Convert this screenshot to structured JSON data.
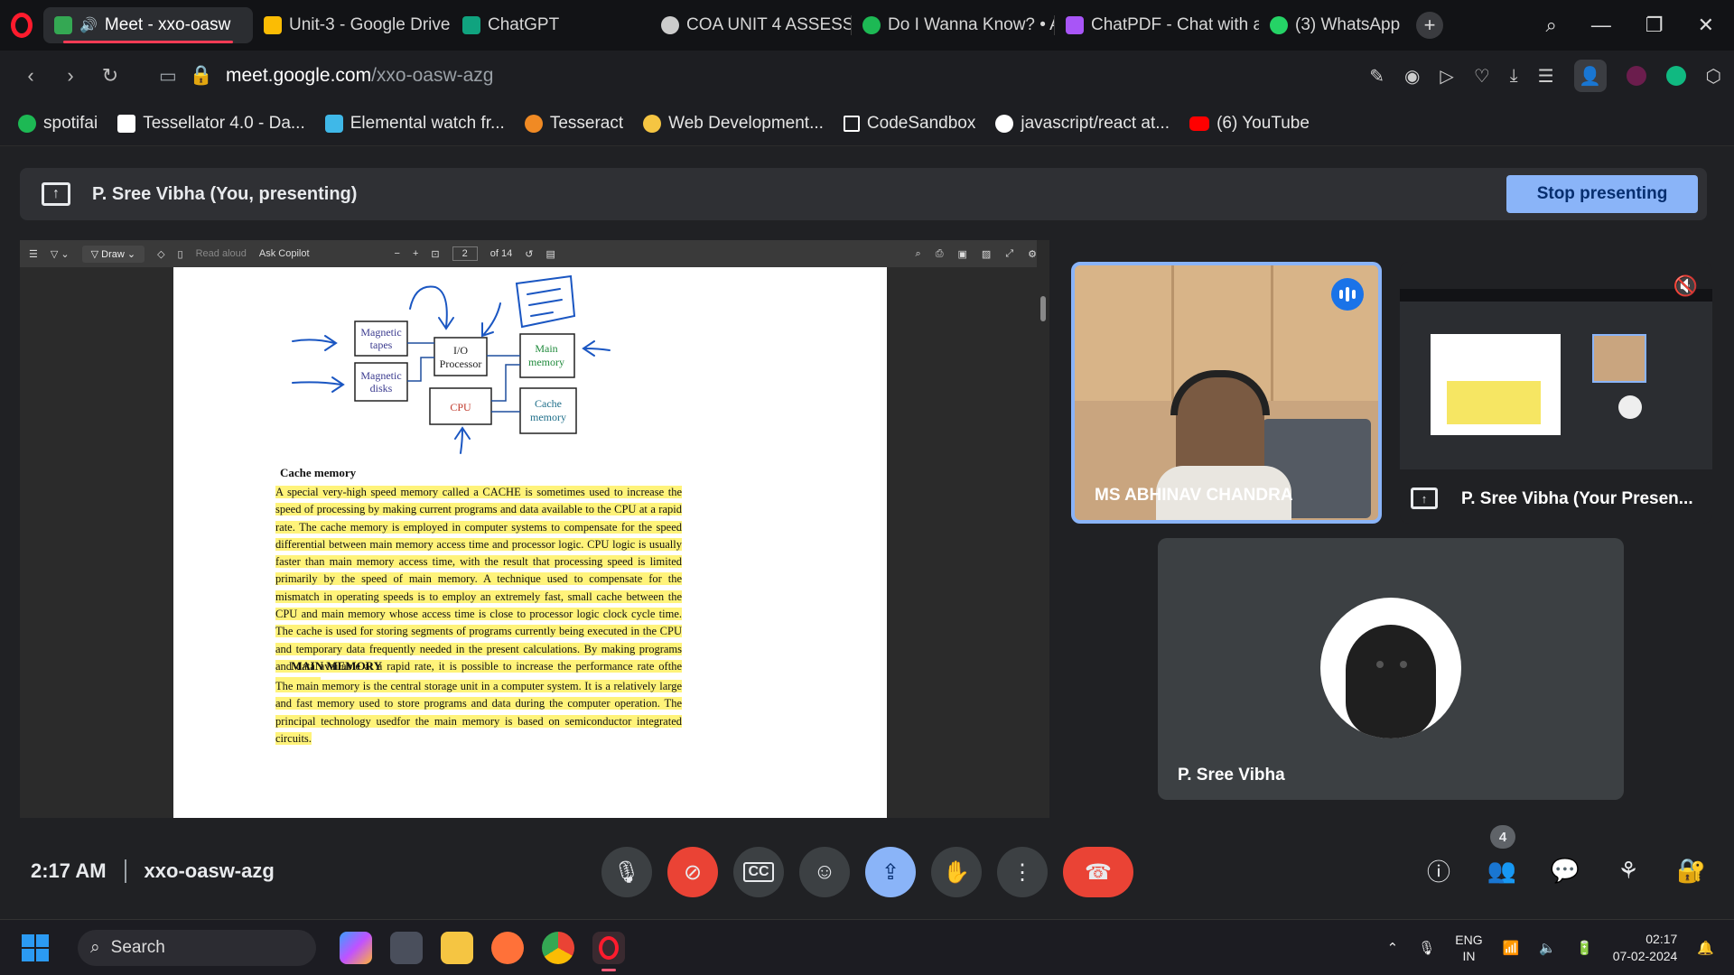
{
  "browser": {
    "tabs": [
      {
        "label": "Meet - xxo-oasw",
        "color": "#34a853",
        "active": true
      },
      {
        "label": "Unit-3 - Google Drive",
        "color": "#fbbc04"
      },
      {
        "label": "ChatGPT",
        "color": "#10a37f"
      },
      {
        "label": "COA UNIT 4 ASSESSME",
        "color": "#cccccc"
      },
      {
        "label": "Do I Wanna Know? • A",
        "color": "#1db954"
      },
      {
        "label": "ChatPDF - Chat with ar",
        "color": "#a855f7"
      },
      {
        "label": "(3) WhatsApp",
        "color": "#25d366"
      }
    ],
    "url_host": "meet.google.com",
    "url_path": "/xxo-oasw-azg",
    "bookmarks": [
      {
        "label": "spotifai",
        "color": "#1db954"
      },
      {
        "label": "Tessellator 4.0 - Da...",
        "color": "#ffffff"
      },
      {
        "label": "Elemental watch fr...",
        "color": "#3fb8e8"
      },
      {
        "label": "Tesseract",
        "color": "#f08a24"
      },
      {
        "label": "Web Development...",
        "color": "#f5c542"
      },
      {
        "label": "CodeSandbox",
        "color": "#ffffff"
      },
      {
        "label": "javascript/react at...",
        "color": "#ffffff"
      },
      {
        "label": "(6) YouTube",
        "color": "#ff0000"
      }
    ]
  },
  "meet": {
    "presenting_text": "P. Sree Vibha (You, presenting)",
    "stop_presenting": "Stop presenting",
    "meeting_time": "2:17 AM",
    "meeting_code": "xxo-oasw-azg",
    "participant_count": "4",
    "participants": {
      "speaker": "MS ABHINAV CHANDRA",
      "presentation": "P. Sree Vibha (Your Presen...",
      "self": "P. Sree Vibha"
    }
  },
  "pdf": {
    "toolbar": {
      "draw": "Draw",
      "read_aloud": "Read aloud",
      "ask_copilot": "Ask Copilot",
      "page": "2",
      "of_pages": "of 14"
    },
    "diagram": {
      "magnetic_tapes": [
        "Magnetic",
        "tapes"
      ],
      "magnetic_disks": [
        "Magnetic",
        "disks"
      ],
      "io_processor": [
        "I/O",
        "Processor"
      ],
      "main_memory": [
        "Main",
        "memory"
      ],
      "cpu": "CPU",
      "cache_memory": [
        "Cache",
        "memory"
      ]
    },
    "cache_heading": "Cache memory",
    "cache_para": "A special very-high speed memory called a CACHE is sometimes used to increase the speed of processing by making current programs and data available to the CPU at a rapid rate. The cache memory is employed in computer systems to compensate for the speed differential between main memory access time and processor logic. CPU logic is usually faster than main memory access time, with the result that processing speed is limited primarily by the speed of main memory. A technique used to compensate for the mismatch in operating speeds is to employ an extremely fast, small cache between the CPU and main memory whose access time is close to processor logic clock cycle time. The cache is used for storing segments of programs currently being executed in the CPU and temporary data frequently needed in the present calculations. By making programs and data available at a rapid rate, it is possible to increase the performance rate ofthe computer.",
    "main_heading": "MAIN MEMORY",
    "main_para": "The main memory is the central storage unit in a computer system. It is a relatively large and fast memory used to store programs and data during the computer operation. The principal technology usedfor the main memory is based on semiconductor integrated circuits."
  },
  "taskbar": {
    "search": "Search",
    "lang": "ENG",
    "region": "IN",
    "time": "02:17",
    "date": "07-02-2024"
  }
}
